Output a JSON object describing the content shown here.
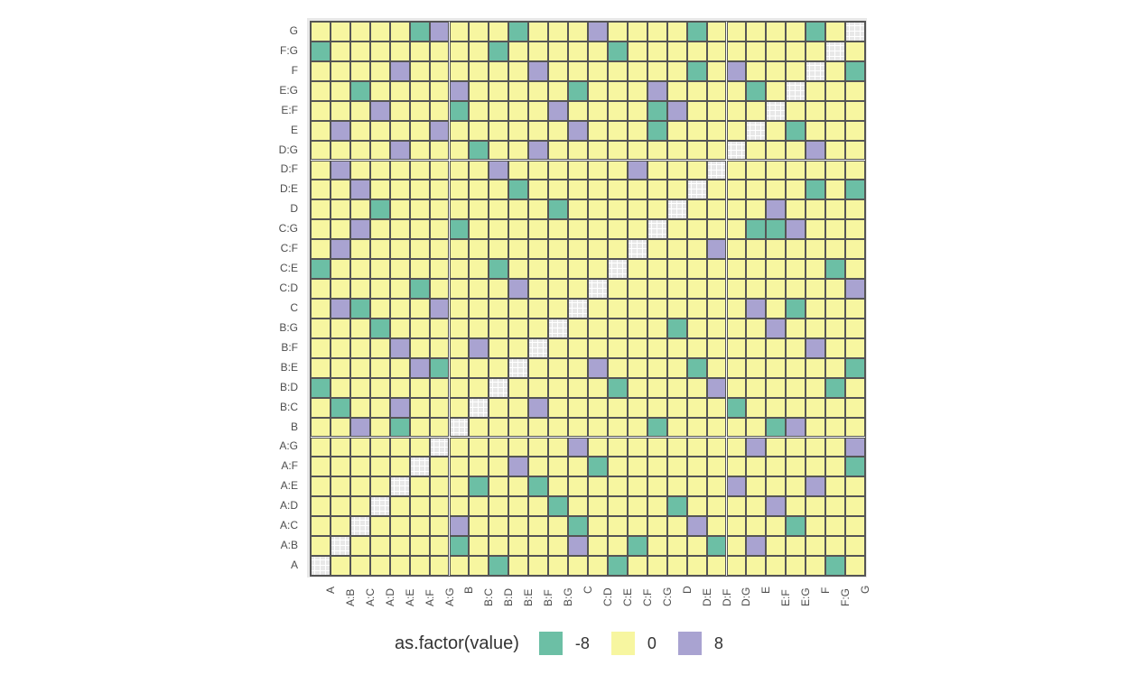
{
  "chart_data": {
    "type": "heatmap",
    "title": "",
    "xlabel": "",
    "ylabel": "",
    "legend_title": "as.factor(value)",
    "levels": [
      {
        "value": -8,
        "color": "#6cbfa5",
        "label": "-8"
      },
      {
        "value": 0,
        "color": "#f7f6a0",
        "label": "0"
      },
      {
        "value": 8,
        "color": "#a9a3d1",
        "label": "8"
      }
    ],
    "na_color": "#e8e8e8",
    "categories": [
      "A",
      "A:B",
      "A:C",
      "A:D",
      "A:E",
      "A:F",
      "A:G",
      "B",
      "B:C",
      "B:D",
      "B:E",
      "B:F",
      "B:G",
      "C",
      "C:D",
      "C:E",
      "C:F",
      "C:G",
      "D",
      "D:E",
      "D:F",
      "D:G",
      "E",
      "E:F",
      "E:G",
      "F",
      "F:G",
      "G"
    ],
    "n": 28,
    "green": [
      [
        0,
        9
      ],
      [
        0,
        15
      ],
      [
        0,
        26
      ],
      [
        1,
        7
      ],
      [
        1,
        16
      ],
      [
        1,
        20
      ],
      [
        2,
        13
      ],
      [
        2,
        24
      ],
      [
        3,
        12
      ],
      [
        3,
        18
      ],
      [
        4,
        8
      ],
      [
        4,
        11
      ],
      [
        5,
        14
      ],
      [
        5,
        27
      ],
      [
        7,
        4
      ],
      [
        7,
        17
      ],
      [
        7,
        23
      ],
      [
        8,
        1
      ],
      [
        8,
        21
      ],
      [
        9,
        0
      ],
      [
        9,
        15
      ],
      [
        9,
        26
      ],
      [
        10,
        6
      ],
      [
        10,
        19
      ],
      [
        10,
        27
      ],
      [
        12,
        3
      ],
      [
        12,
        18
      ],
      [
        13,
        2
      ],
      [
        13,
        24
      ],
      [
        14,
        5
      ],
      [
        15,
        0
      ],
      [
        15,
        9
      ],
      [
        15,
        26
      ],
      [
        17,
        7
      ],
      [
        17,
        22
      ],
      [
        17,
        23
      ],
      [
        18,
        3
      ],
      [
        18,
        12
      ],
      [
        19,
        10
      ],
      [
        19,
        25
      ],
      [
        19,
        27
      ],
      [
        21,
        8
      ],
      [
        22,
        17
      ],
      [
        22,
        24
      ],
      [
        23,
        7
      ],
      [
        23,
        17
      ],
      [
        24,
        2
      ],
      [
        24,
        13
      ],
      [
        24,
        22
      ],
      [
        25,
        19
      ],
      [
        25,
        27
      ],
      [
        26,
        0
      ],
      [
        26,
        9
      ],
      [
        26,
        15
      ],
      [
        27,
        5
      ],
      [
        27,
        10
      ],
      [
        27,
        19
      ],
      [
        27,
        25
      ]
    ],
    "purple": [
      [
        1,
        13
      ],
      [
        1,
        22
      ],
      [
        2,
        7
      ],
      [
        2,
        19
      ],
      [
        3,
        23
      ],
      [
        4,
        21
      ],
      [
        4,
        25
      ],
      [
        5,
        10
      ],
      [
        6,
        13
      ],
      [
        6,
        22
      ],
      [
        6,
        27
      ],
      [
        7,
        2
      ],
      [
        7,
        24
      ],
      [
        8,
        4
      ],
      [
        8,
        11
      ],
      [
        9,
        20
      ],
      [
        10,
        5
      ],
      [
        10,
        14
      ],
      [
        11,
        4
      ],
      [
        11,
        8
      ],
      [
        11,
        25
      ],
      [
        12,
        23
      ],
      [
        13,
        1
      ],
      [
        13,
        6
      ],
      [
        13,
        22
      ],
      [
        14,
        10
      ],
      [
        14,
        27
      ],
      [
        16,
        1
      ],
      [
        16,
        20
      ],
      [
        17,
        2
      ],
      [
        17,
        24
      ],
      [
        18,
        23
      ],
      [
        19,
        2
      ],
      [
        20,
        1
      ],
      [
        20,
        9
      ],
      [
        20,
        16
      ],
      [
        21,
        4
      ],
      [
        21,
        11
      ],
      [
        21,
        25
      ],
      [
        22,
        1
      ],
      [
        22,
        13
      ],
      [
        22,
        6
      ],
      [
        23,
        3
      ],
      [
        23,
        12
      ],
      [
        23,
        18
      ],
      [
        24,
        7
      ],
      [
        24,
        17
      ],
      [
        25,
        4
      ],
      [
        25,
        11
      ],
      [
        25,
        21
      ],
      [
        27,
        6
      ],
      [
        27,
        14
      ]
    ]
  }
}
